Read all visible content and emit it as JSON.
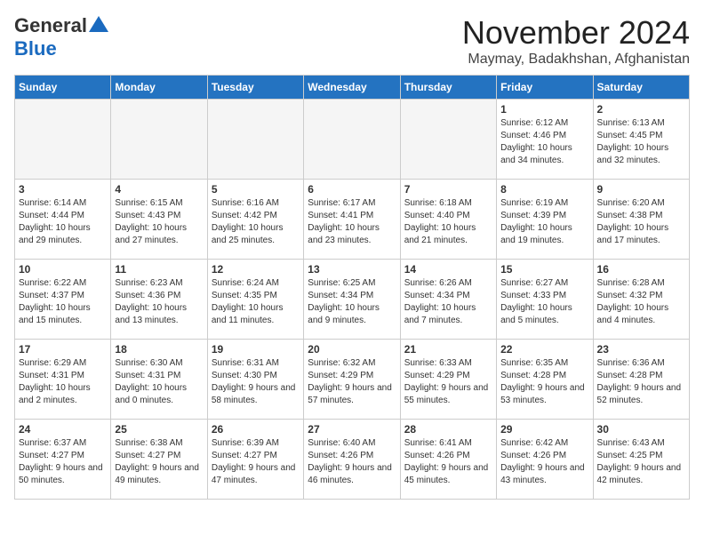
{
  "logo": {
    "general": "General",
    "blue": "Blue"
  },
  "title": "November 2024",
  "location": "Maymay, Badakhshan, Afghanistan",
  "days_of_week": [
    "Sunday",
    "Monday",
    "Tuesday",
    "Wednesday",
    "Thursday",
    "Friday",
    "Saturday"
  ],
  "weeks": [
    [
      {
        "num": "",
        "info": ""
      },
      {
        "num": "",
        "info": ""
      },
      {
        "num": "",
        "info": ""
      },
      {
        "num": "",
        "info": ""
      },
      {
        "num": "",
        "info": ""
      },
      {
        "num": "1",
        "info": "Sunrise: 6:12 AM\nSunset: 4:46 PM\nDaylight: 10 hours and 34 minutes."
      },
      {
        "num": "2",
        "info": "Sunrise: 6:13 AM\nSunset: 4:45 PM\nDaylight: 10 hours and 32 minutes."
      }
    ],
    [
      {
        "num": "3",
        "info": "Sunrise: 6:14 AM\nSunset: 4:44 PM\nDaylight: 10 hours and 29 minutes."
      },
      {
        "num": "4",
        "info": "Sunrise: 6:15 AM\nSunset: 4:43 PM\nDaylight: 10 hours and 27 minutes."
      },
      {
        "num": "5",
        "info": "Sunrise: 6:16 AM\nSunset: 4:42 PM\nDaylight: 10 hours and 25 minutes."
      },
      {
        "num": "6",
        "info": "Sunrise: 6:17 AM\nSunset: 4:41 PM\nDaylight: 10 hours and 23 minutes."
      },
      {
        "num": "7",
        "info": "Sunrise: 6:18 AM\nSunset: 4:40 PM\nDaylight: 10 hours and 21 minutes."
      },
      {
        "num": "8",
        "info": "Sunrise: 6:19 AM\nSunset: 4:39 PM\nDaylight: 10 hours and 19 minutes."
      },
      {
        "num": "9",
        "info": "Sunrise: 6:20 AM\nSunset: 4:38 PM\nDaylight: 10 hours and 17 minutes."
      }
    ],
    [
      {
        "num": "10",
        "info": "Sunrise: 6:22 AM\nSunset: 4:37 PM\nDaylight: 10 hours and 15 minutes."
      },
      {
        "num": "11",
        "info": "Sunrise: 6:23 AM\nSunset: 4:36 PM\nDaylight: 10 hours and 13 minutes."
      },
      {
        "num": "12",
        "info": "Sunrise: 6:24 AM\nSunset: 4:35 PM\nDaylight: 10 hours and 11 minutes."
      },
      {
        "num": "13",
        "info": "Sunrise: 6:25 AM\nSunset: 4:34 PM\nDaylight: 10 hours and 9 minutes."
      },
      {
        "num": "14",
        "info": "Sunrise: 6:26 AM\nSunset: 4:34 PM\nDaylight: 10 hours and 7 minutes."
      },
      {
        "num": "15",
        "info": "Sunrise: 6:27 AM\nSunset: 4:33 PM\nDaylight: 10 hours and 5 minutes."
      },
      {
        "num": "16",
        "info": "Sunrise: 6:28 AM\nSunset: 4:32 PM\nDaylight: 10 hours and 4 minutes."
      }
    ],
    [
      {
        "num": "17",
        "info": "Sunrise: 6:29 AM\nSunset: 4:31 PM\nDaylight: 10 hours and 2 minutes."
      },
      {
        "num": "18",
        "info": "Sunrise: 6:30 AM\nSunset: 4:31 PM\nDaylight: 10 hours and 0 minutes."
      },
      {
        "num": "19",
        "info": "Sunrise: 6:31 AM\nSunset: 4:30 PM\nDaylight: 9 hours and 58 minutes."
      },
      {
        "num": "20",
        "info": "Sunrise: 6:32 AM\nSunset: 4:29 PM\nDaylight: 9 hours and 57 minutes."
      },
      {
        "num": "21",
        "info": "Sunrise: 6:33 AM\nSunset: 4:29 PM\nDaylight: 9 hours and 55 minutes."
      },
      {
        "num": "22",
        "info": "Sunrise: 6:35 AM\nSunset: 4:28 PM\nDaylight: 9 hours and 53 minutes."
      },
      {
        "num": "23",
        "info": "Sunrise: 6:36 AM\nSunset: 4:28 PM\nDaylight: 9 hours and 52 minutes."
      }
    ],
    [
      {
        "num": "24",
        "info": "Sunrise: 6:37 AM\nSunset: 4:27 PM\nDaylight: 9 hours and 50 minutes."
      },
      {
        "num": "25",
        "info": "Sunrise: 6:38 AM\nSunset: 4:27 PM\nDaylight: 9 hours and 49 minutes."
      },
      {
        "num": "26",
        "info": "Sunrise: 6:39 AM\nSunset: 4:27 PM\nDaylight: 9 hours and 47 minutes."
      },
      {
        "num": "27",
        "info": "Sunrise: 6:40 AM\nSunset: 4:26 PM\nDaylight: 9 hours and 46 minutes."
      },
      {
        "num": "28",
        "info": "Sunrise: 6:41 AM\nSunset: 4:26 PM\nDaylight: 9 hours and 45 minutes."
      },
      {
        "num": "29",
        "info": "Sunrise: 6:42 AM\nSunset: 4:26 PM\nDaylight: 9 hours and 43 minutes."
      },
      {
        "num": "30",
        "info": "Sunrise: 6:43 AM\nSunset: 4:25 PM\nDaylight: 9 hours and 42 minutes."
      }
    ]
  ]
}
